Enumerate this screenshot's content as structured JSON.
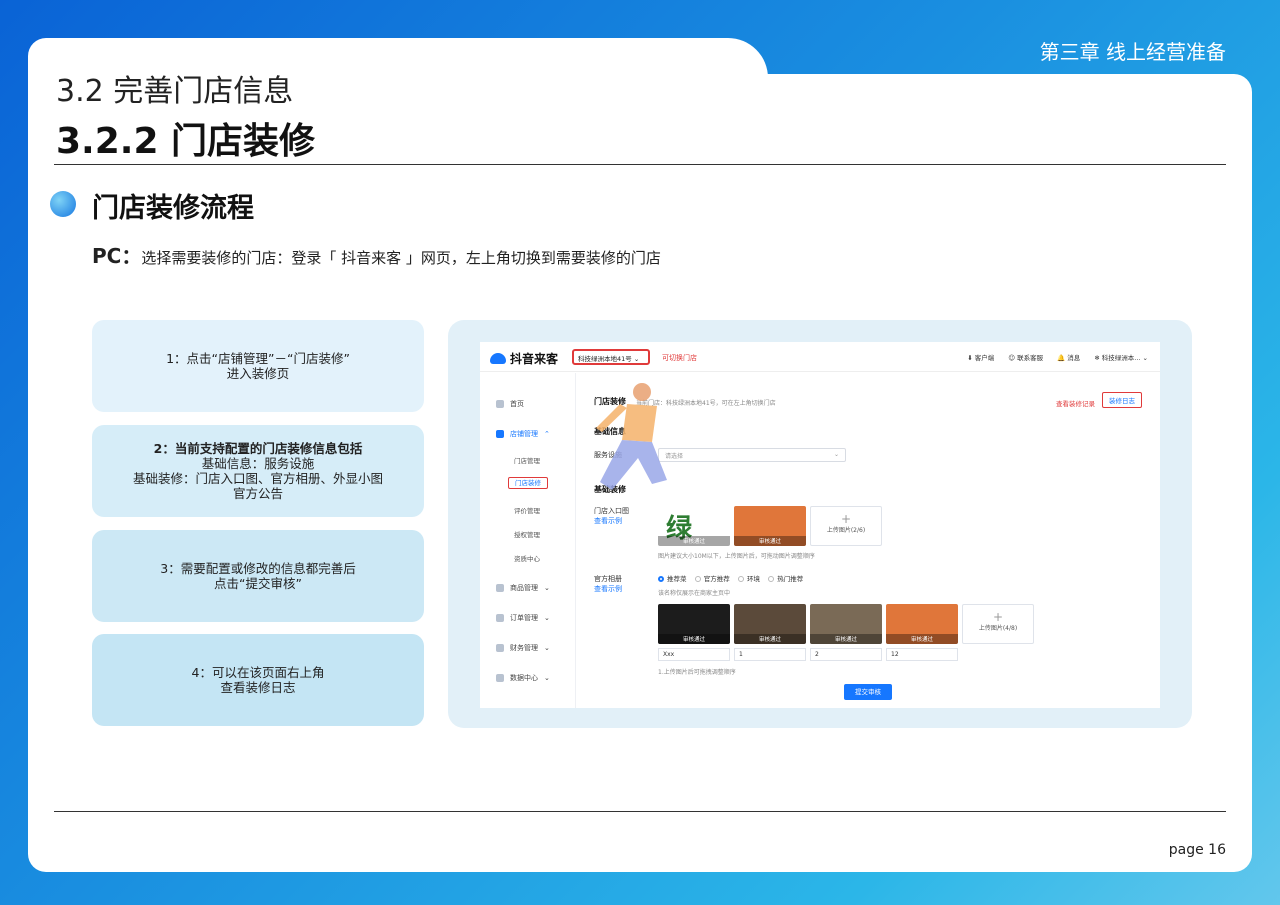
{
  "header": {
    "chapter": "第三章 线上经营准备",
    "section_title": "3.2 完善门店信息",
    "subsection_title": "3.2.2 门店装修"
  },
  "flow": {
    "title": "门店装修流程",
    "pc_label": "PC：",
    "pc_text": "选择需要装修的门店：登录「 抖音来客 」网页，左上角切换到需要装修的门店"
  },
  "steps": [
    {
      "lines": [
        "1：点击“店铺管理”－“门店装修”",
        "进入装修页"
      ],
      "bg": "#e3f2fb"
    },
    {
      "lines": [
        "2：当前支持配置的门店装修信息包括",
        "基础信息：服务设施",
        "基础装修：门店入口图、官方相册、外显小图",
        "官方公告"
      ],
      "bg": "#d6edf8"
    },
    {
      "lines": [
        "3：需要配置或修改的信息都完善后",
        "点击“提交审核”"
      ],
      "bg": "#cce8f5"
    },
    {
      "lines": [
        "4：可以在该页面右上角",
        "查看装修日志"
      ],
      "bg": "#c4e5f4"
    }
  ],
  "screenshot": {
    "logo": "抖音来客",
    "store_selector": "科技绿洲本地41号",
    "switch_link": "可切换门店",
    "top_actions": [
      "客户端",
      "联系客服",
      "消息",
      "科技绿洲本..."
    ],
    "sidebar": {
      "home": "首页",
      "store_mgmt": "店铺管理",
      "store_sub": [
        "门店管理",
        "门店装修",
        "评价管理",
        "授权管理",
        "资质中心"
      ],
      "goods": "商品管理",
      "orders": "订单管理",
      "finance": "财务管理",
      "data": "数据中心"
    },
    "content": {
      "page_title": "门店装修",
      "page_hint": "当前门店：科技绿洲本地41号，可在左上角切换门店",
      "record_link": "查看装修记录",
      "log_button": "装修日志",
      "basic_info": "基础信息",
      "service_label": "服务设施",
      "service_placeholder": "请选择",
      "basic_decor": "基础装修",
      "entrance_label": "门店入口图",
      "view_example": "查看示例",
      "entrance_thumbs": [
        "审核通过",
        "审核通过"
      ],
      "upload_entrance": "上传图片(2/6)",
      "entrance_hint": "图片建议大小10M以下，上传图片后，可拖动图片调整顺序",
      "album_label": "官方相册",
      "album_view_example": "查看示例",
      "album_tabs": [
        "推荐菜",
        "官方推荐",
        "环境",
        "热门推荐"
      ],
      "album_hint": "该名称仅展示在商家主页中",
      "album_thumbs": [
        "审核通过",
        "审核通过",
        "审核通过",
        "审核通过"
      ],
      "album_names": [
        "Xxx",
        "1",
        "2",
        "12"
      ],
      "upload_album": "上传图片(4/8)",
      "album_drag_hint": "1.上传图片后可拖拽调整顺序",
      "submit": "提交审核"
    }
  },
  "footer": {
    "page": "page 16"
  }
}
